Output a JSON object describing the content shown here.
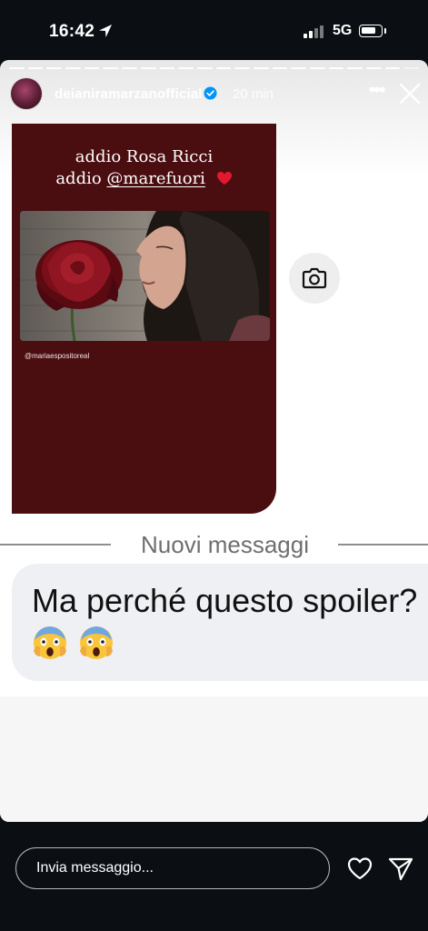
{
  "status_bar": {
    "time": "16:42",
    "network": "5G",
    "battery_level": 0.7
  },
  "story": {
    "username": "deianiramarzanofficial",
    "time_ago": "20 min",
    "progress_segments": 22,
    "progress_active": 21
  },
  "post": {
    "line1": "addio Rosa Ricci",
    "line2_prefix": "addio",
    "line2_mention": "@marefuori",
    "credit": "@mariaespositoreal"
  },
  "divider_label": "Nuovi messaggi",
  "message": {
    "text": "Ma perché questo spoiler?",
    "emojis": [
      "scream",
      "scream"
    ]
  },
  "reply": {
    "placeholder": "Invia messaggio..."
  },
  "icons": {
    "location_arrow": "location-arrow-icon",
    "verified": "verified-badge-icon",
    "more": "more-horizontal-icon",
    "close": "close-icon",
    "camera": "camera-icon",
    "heart": "heart-outline-icon",
    "send": "paper-plane-icon"
  },
  "colors": {
    "post_background": "#4a0d10",
    "verified": "#0095f6"
  }
}
